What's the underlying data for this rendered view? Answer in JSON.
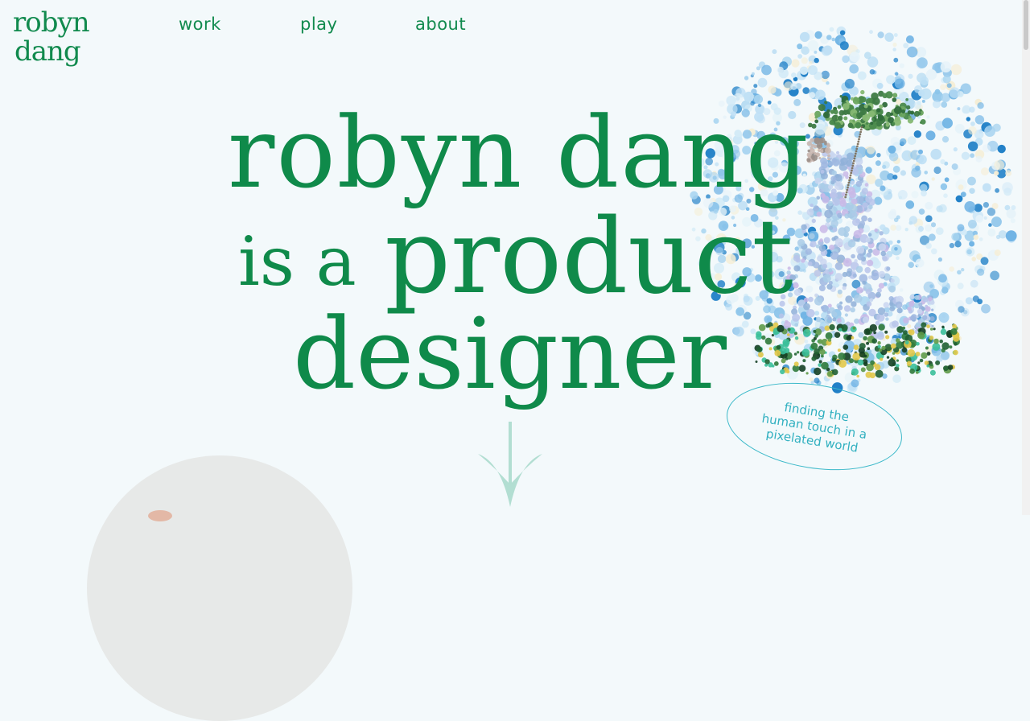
{
  "logo": {
    "line1": "robyn",
    "line2": "dang"
  },
  "nav": {
    "items": [
      {
        "label": "work"
      },
      {
        "label": "play"
      },
      {
        "label": "about"
      }
    ]
  },
  "hero": {
    "line1": "robyn dang",
    "line2_small": "is a",
    "line2_large": "product",
    "line3": "designer"
  },
  "tagline": "finding the\nhuman touch in a\npixelated world",
  "colors": {
    "brand_green": "#0f8a4a",
    "background": "#f3f9fb",
    "tagline_teal": "#31b0c0",
    "arrow_mint": "#b2ded2"
  },
  "icons": {
    "scroll": "arrow-down-icon"
  }
}
